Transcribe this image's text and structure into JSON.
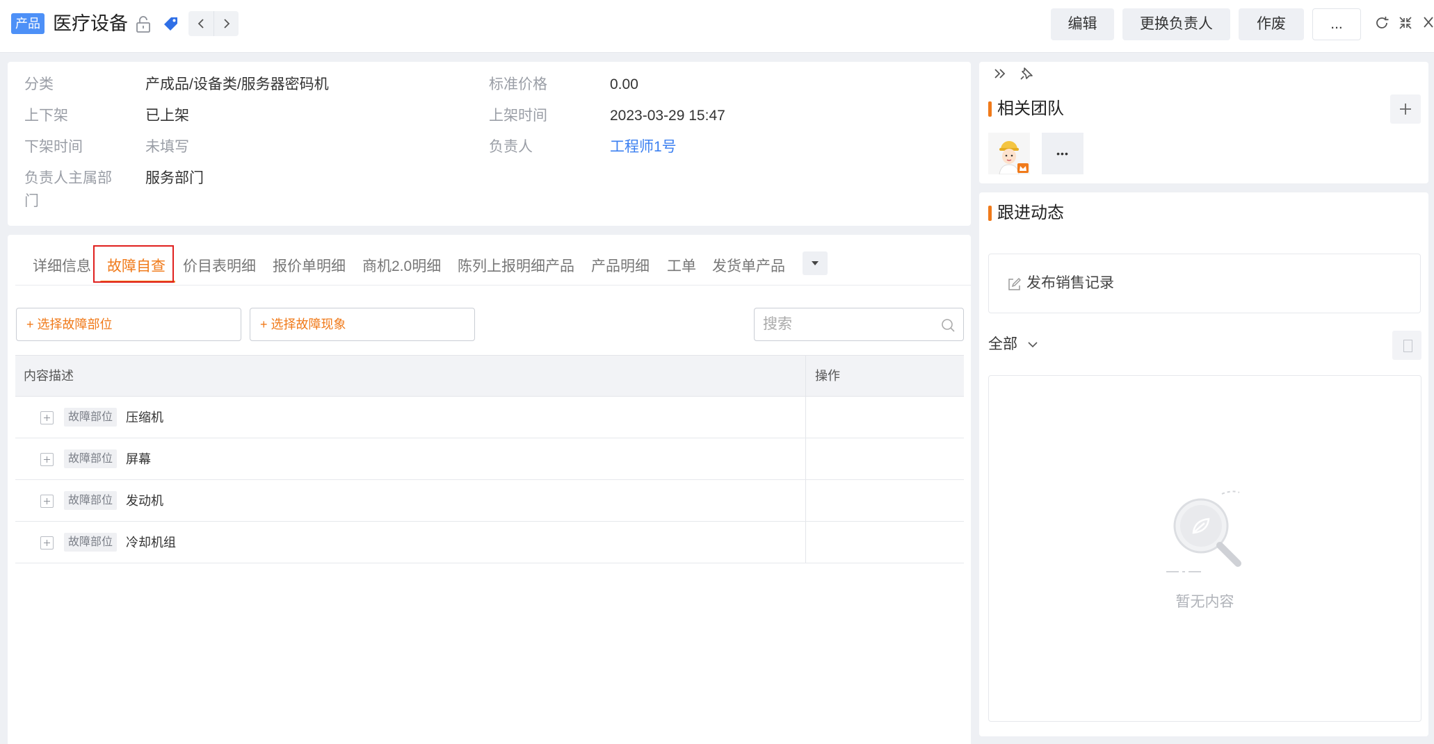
{
  "header": {
    "object_type": "产品",
    "title": "医疗设备",
    "buttons": {
      "edit": "编辑",
      "change_owner": "更换负责人",
      "void": "作废",
      "more": "..."
    }
  },
  "info": {
    "category_label": "分类",
    "category_value": "产成品/设备类/服务器密码机",
    "price_label": "标准价格",
    "price_value": "0.00",
    "shelf_label": "上下架",
    "shelf_value": "已上架",
    "on_time_label": "上架时间",
    "on_time_value": "2023-03-29 15:47",
    "off_time_label": "下架时间",
    "off_time_value": "未填写",
    "owner_label": "负责人",
    "owner_value": "工程师1号",
    "dept_label_line1": "负责人主属部",
    "dept_label_line2": "门",
    "dept_value": "服务部门"
  },
  "tabs": [
    "详细信息",
    "故障自查",
    "价目表明细",
    "报价单明细",
    "商机2.0明细",
    "陈列上报明细产品",
    "产品明细",
    "工单",
    "发货单产品"
  ],
  "active_tab": "故障自查",
  "fault": {
    "select_part": "+ 选择故障部位",
    "select_symptom": "+ 选择故障现象",
    "search_placeholder": "搜索",
    "col_content": "内容描述",
    "col_action": "操作",
    "rows": [
      {
        "tag": "故障部位",
        "text": "压缩机"
      },
      {
        "tag": "故障部位",
        "text": "屏幕"
      },
      {
        "tag": "故障部位",
        "text": "发动机"
      },
      {
        "tag": "故障部位",
        "text": "冷却机组"
      }
    ]
  },
  "sidebar": {
    "team_title": "相关团队",
    "activity_title": "跟进动态",
    "publish_label": "发布销售记录",
    "filter_label": "全部",
    "empty_text": "暂无内容",
    "more_dots": "•••"
  },
  "colors": {
    "accent": "#f07a1a",
    "link": "#3b7ff0",
    "badge": "#4d90f7",
    "highlight_border": "#e0201e"
  }
}
